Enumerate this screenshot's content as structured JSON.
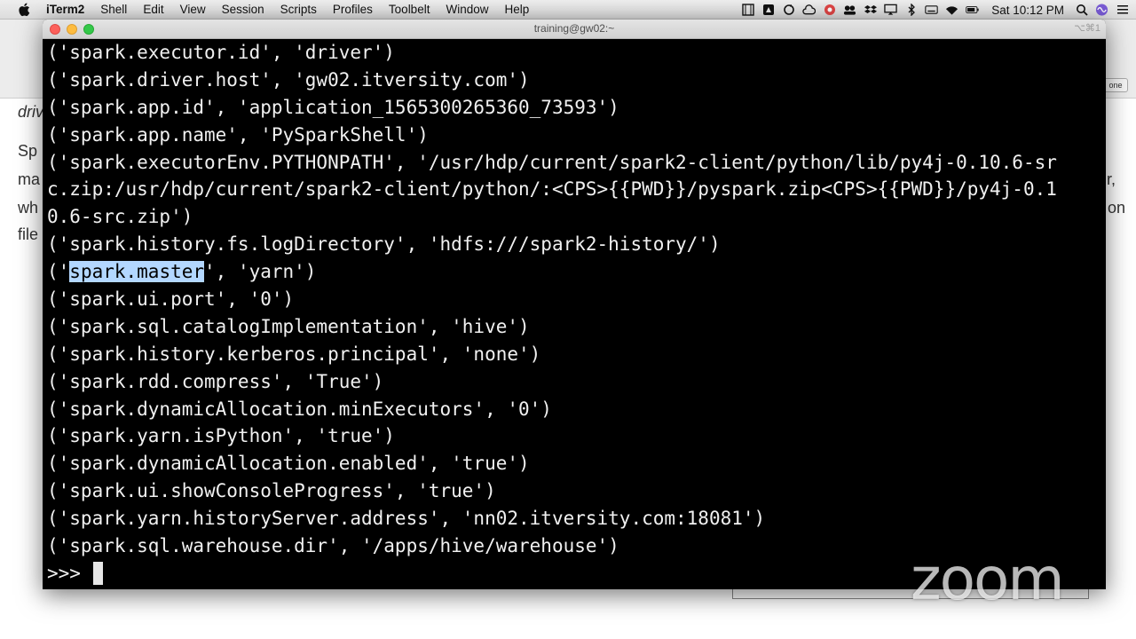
{
  "menubar": {
    "app_name": "iTerm2",
    "items": [
      "Shell",
      "Edit",
      "View",
      "Session",
      "Scripts",
      "Profiles",
      "Toolbelt",
      "Window",
      "Help"
    ],
    "clock": "Sat 10:12 PM"
  },
  "background_page": {
    "lines": [
      "driv",
      "Sp",
      "ma",
      "wh",
      "file",
      "r,",
      "on"
    ],
    "button_label": "one"
  },
  "terminal": {
    "window_title": "training@gw02:~",
    "shortcut": "⌥⌘1",
    "lines": [
      "('spark.executor.id', 'driver')",
      "('spark.driver.host', 'gw02.itversity.com')",
      "('spark.app.id', 'application_1565300265360_73593')",
      "('spark.app.name', 'PySparkShell')",
      "('spark.executorEnv.PYTHONPATH', '/usr/hdp/current/spark2-client/python/lib/py4j-0.10.6-sr",
      "c.zip:/usr/hdp/current/spark2-client/python/:<CPS>{{PWD}}/pyspark.zip<CPS>{{PWD}}/py4j-0.1",
      "0.6-src.zip')",
      "('spark.history.fs.logDirectory', 'hdfs:///spark2-history/')"
    ],
    "selected_line": {
      "prefix": "('",
      "selection": "spark.master",
      "suffix": "', 'yarn')"
    },
    "lines_after": [
      "('spark.ui.port', '0')",
      "('spark.sql.catalogImplementation', 'hive')",
      "('spark.history.kerberos.principal', 'none')",
      "('spark.rdd.compress', 'True')",
      "('spark.dynamicAllocation.minExecutors', '0')",
      "('spark.yarn.isPython', 'true')",
      "('spark.dynamicAllocation.enabled', 'true')",
      "('spark.ui.showConsoleProgress', 'true')",
      "('spark.yarn.historyServer.address', 'nn02.itversity.com:18081')",
      "('spark.sql.warehouse.dir', '/apps/hive/warehouse')"
    ],
    "prompt": ">>>"
  },
  "watermark": "zoom",
  "colors": {
    "terminal_bg": "#000000",
    "terminal_fg": "#f0f0f0",
    "selection": "#b3d7ff"
  }
}
